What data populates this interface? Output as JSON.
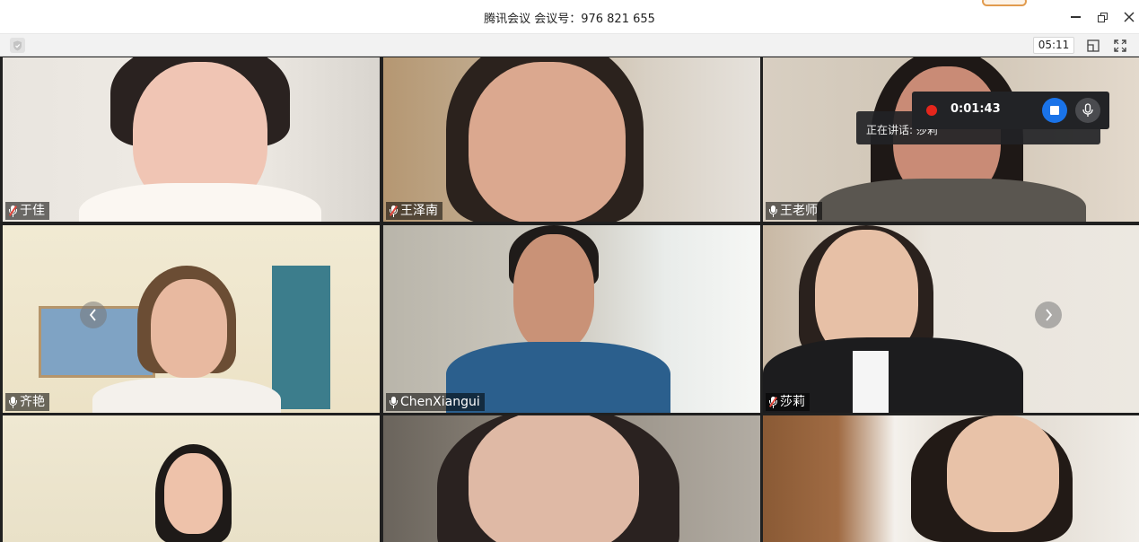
{
  "titlebar": {
    "title": "腾讯会议 会议号：976 821 655"
  },
  "toolbar": {
    "elapsed": "05:11"
  },
  "recording": {
    "time": "0:01:43",
    "speaking_prefix": "正在讲话: ",
    "speaking_name": "莎莉"
  },
  "participants": [
    {
      "name": "于佳",
      "muted": true
    },
    {
      "name": "王泽南",
      "muted": true
    },
    {
      "name": "王老师",
      "muted": false
    },
    {
      "name": "齐艳",
      "muted": false
    },
    {
      "name": "ChenXiangui",
      "muted": false
    },
    {
      "name": "莎莉",
      "muted": true
    },
    {
      "name": "",
      "muted": false
    },
    {
      "name": "",
      "muted": false
    },
    {
      "name": "",
      "muted": false
    }
  ],
  "colors": {
    "record_red": "#e5261c",
    "stop_blue": "#1a73e8",
    "muted_slash": "#e2463b"
  },
  "icons": {
    "shield": "shield-icon",
    "layout": "layout-icon",
    "fullscreen": "fullscreen-icon",
    "prev": "chevron-left-icon",
    "next": "chevron-right-icon"
  }
}
